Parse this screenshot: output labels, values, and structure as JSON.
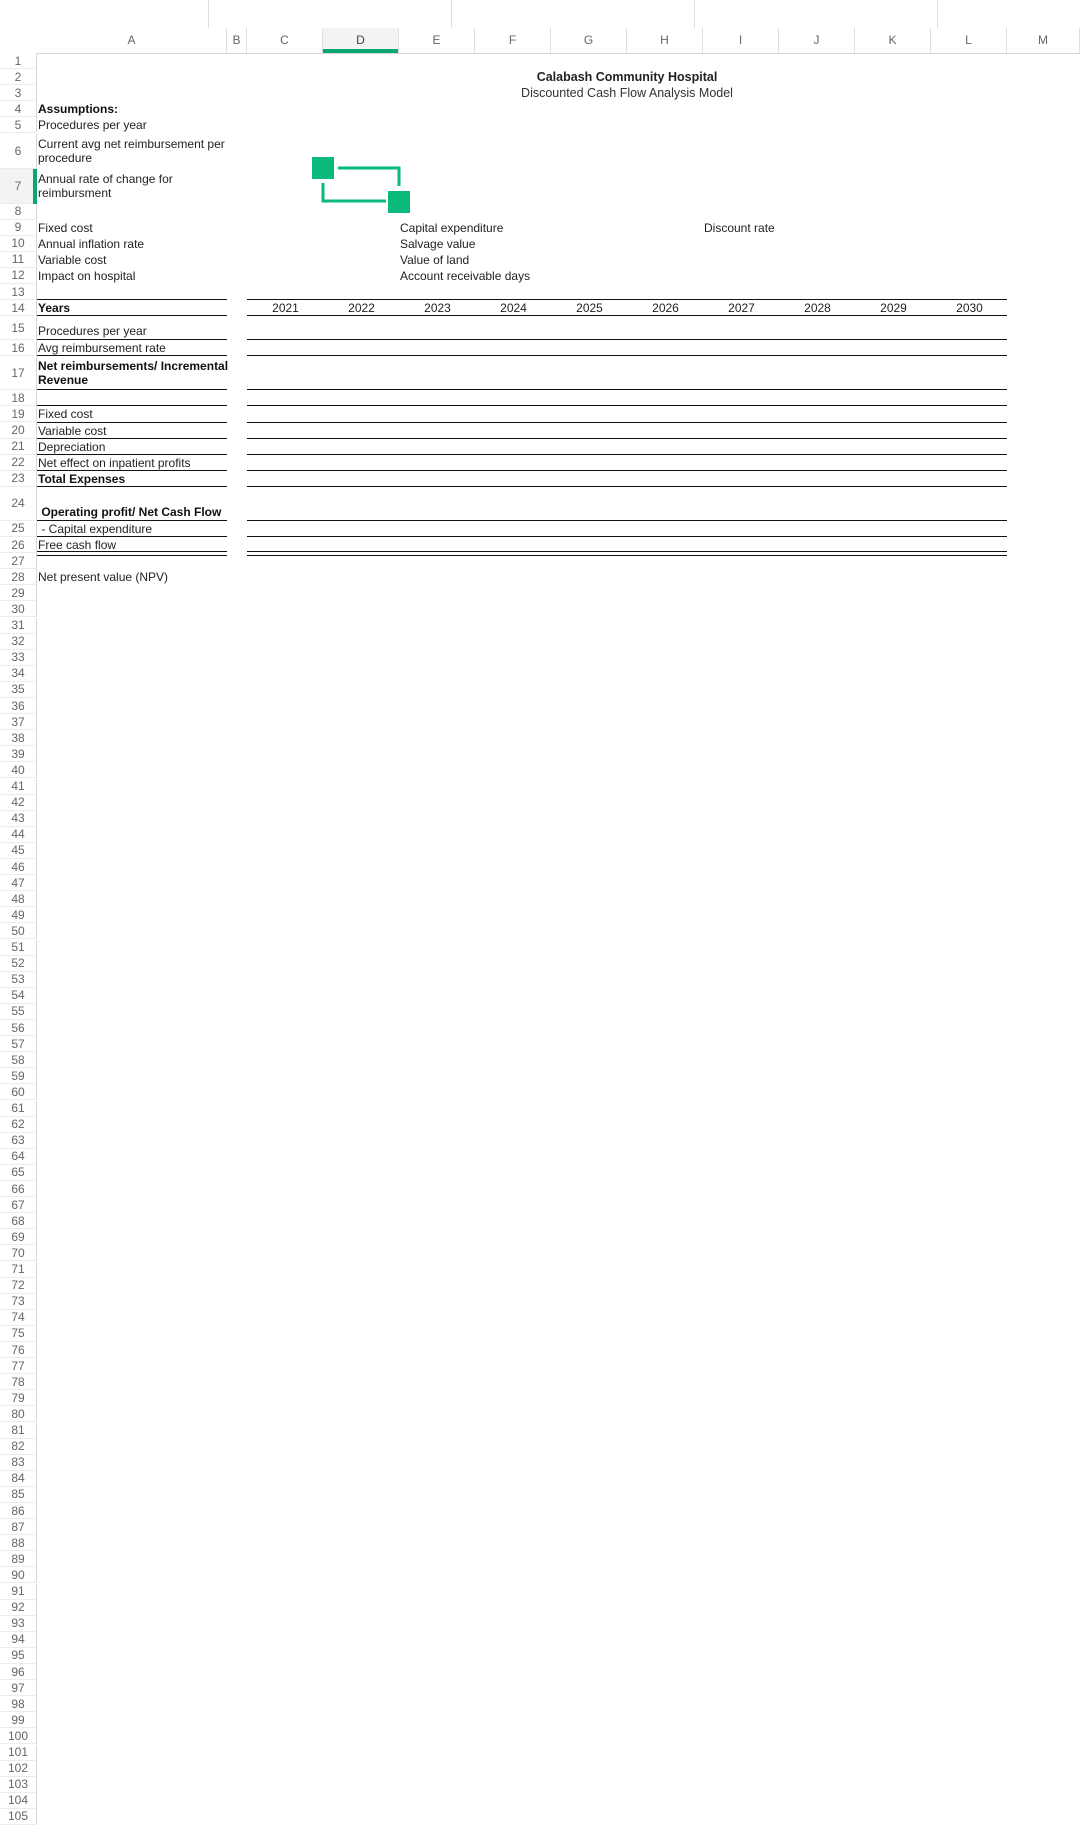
{
  "spreadsheet": {
    "columns": [
      "A",
      "B",
      "C",
      "D",
      "E",
      "F",
      "G",
      "H",
      "I",
      "J",
      "K",
      "L",
      "M"
    ],
    "selected_column": "D",
    "selected_row": "7",
    "row_count_visible": 105
  },
  "title": {
    "line1": "Calabash Community Hospital",
    "line2": "Discounted Cash Flow Analysis Model"
  },
  "assumptions": {
    "heading": "Assumptions:",
    "left": [
      {
        "row": 5,
        "label": "Procedures per year"
      },
      {
        "row": 6,
        "label": "Current avg net reimbursement per procedure"
      },
      {
        "row": 7,
        "label": "Annual rate of change for reimbursment"
      },
      {
        "row": 9,
        "label": "Fixed cost"
      },
      {
        "row": 10,
        "label": "Annual inflation rate"
      },
      {
        "row": 11,
        "label": "Variable cost"
      },
      {
        "row": 12,
        "label": "Impact on hospital"
      }
    ],
    "middle": [
      {
        "row": 9,
        "label": "Capital expenditure"
      },
      {
        "row": 10,
        "label": "Salvage value"
      },
      {
        "row": 11,
        "label": "Value of land"
      },
      {
        "row": 12,
        "label": "Account receivable days"
      }
    ],
    "right": [
      {
        "row": 9,
        "label": "Discount rate"
      }
    ]
  },
  "table": {
    "header_label": "Years",
    "years": [
      "2021",
      "2022",
      "2023",
      "2024",
      "2025",
      "2026",
      "2027",
      "2028",
      "2029",
      "2030"
    ],
    "rows": [
      {
        "row": 15,
        "label": "Procedures per year",
        "bold": false
      },
      {
        "row": 16,
        "label": "Avg reimbursement rate",
        "bold": false
      },
      {
        "row": 17,
        "label": "Net reimbursements/ Incremental Revenue",
        "bold": true
      },
      {
        "row": 18,
        "label": "",
        "bold": false
      },
      {
        "row": 19,
        "label": "Fixed cost",
        "bold": false
      },
      {
        "row": 20,
        "label": "Variable cost",
        "bold": false
      },
      {
        "row": 21,
        "label": "Depreciation",
        "bold": false
      },
      {
        "row": 22,
        "label": "Net effect on inpatient profits",
        "bold": false
      },
      {
        "row": 23,
        "label": "Total Expenses",
        "bold": true
      },
      {
        "row": 24,
        "label": " Operating profit/ Net Cash Flow",
        "bold": true
      },
      {
        "row": 25,
        "label": " - Capital expenditure",
        "bold": false
      },
      {
        "row": 26,
        "label": "Free cash flow",
        "bold": false
      }
    ],
    "npv_label": "Net present value (NPV)"
  },
  "overlay": {
    "icon": "connector-shape-icon",
    "color": "#0aba7a"
  },
  "colors": {
    "accent": "#0aa86e"
  }
}
